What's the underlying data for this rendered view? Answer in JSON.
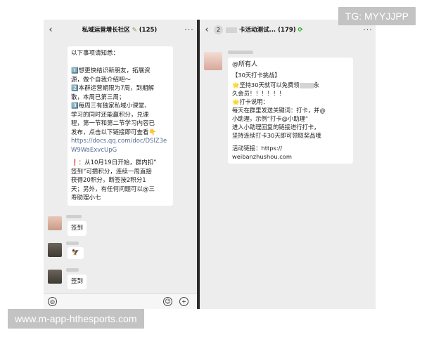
{
  "left_chat": {
    "back_icon": "chevron-left-icon",
    "title": "私域运营增长社区",
    "member_count": "(125)",
    "more_icon": "more-dots-icon",
    "notice_lines": [
      "以下事项请知悉：",
      "",
      "1️⃣想更快结识新朋友，拓展资",
      "源，做个自我介绍吧～",
      "2️⃣本群运营期限为7周，到期解",
      "散，本周已第三周；",
      "3️⃣每周三有独家私域小课堂、",
      "学习的同时还能赢积分，兑课",
      "程，第一节和第二节学习内容已",
      "发布，点击以下链接即可查看👇"
    ],
    "link_lines": [
      "https://docs.qq.com/doc/DSlZ3e",
      "W9WaExvcUpG"
    ],
    "notice_lines_2": [
      "❗：从10月19日开始，群内扣”",
      "签到”可攒积分，连续一周直接",
      "获得20积分，断签按2积分1",
      "天；另外，有任何问题可以@三",
      "寿助理小七"
    ],
    "msg1": "签到",
    "msg2": "🦅",
    "msg3": "签到"
  },
  "right_chat": {
    "back_icon": "chevron-left-icon",
    "unread_badge": "2",
    "title": "卡活动测试...",
    "member_count": "(179)",
    "more_icon": "more-dots-icon",
    "at_all": "@所有人",
    "lines": [
      "【30天打卡挑战】",
      "🌟坚持30天就可以免费领",
      "久会员！！！！！！",
      "🌟打卡说明：",
      "每天在群里发送关键词：打卡，并@",
      "小助理，示例“打卡@小助理”",
      "进入小助理回复的链接进行打卡，",
      "坚持连续打卡30天即可领取奖品哦",
      "",
      "活动链接：https://",
      "weibanzhushou.com"
    ],
    "yong_char": "永"
  },
  "watermarks": {
    "top_right": "TG: MYYJJPP",
    "bottom_left": "www.m-app-hthesports.com"
  }
}
